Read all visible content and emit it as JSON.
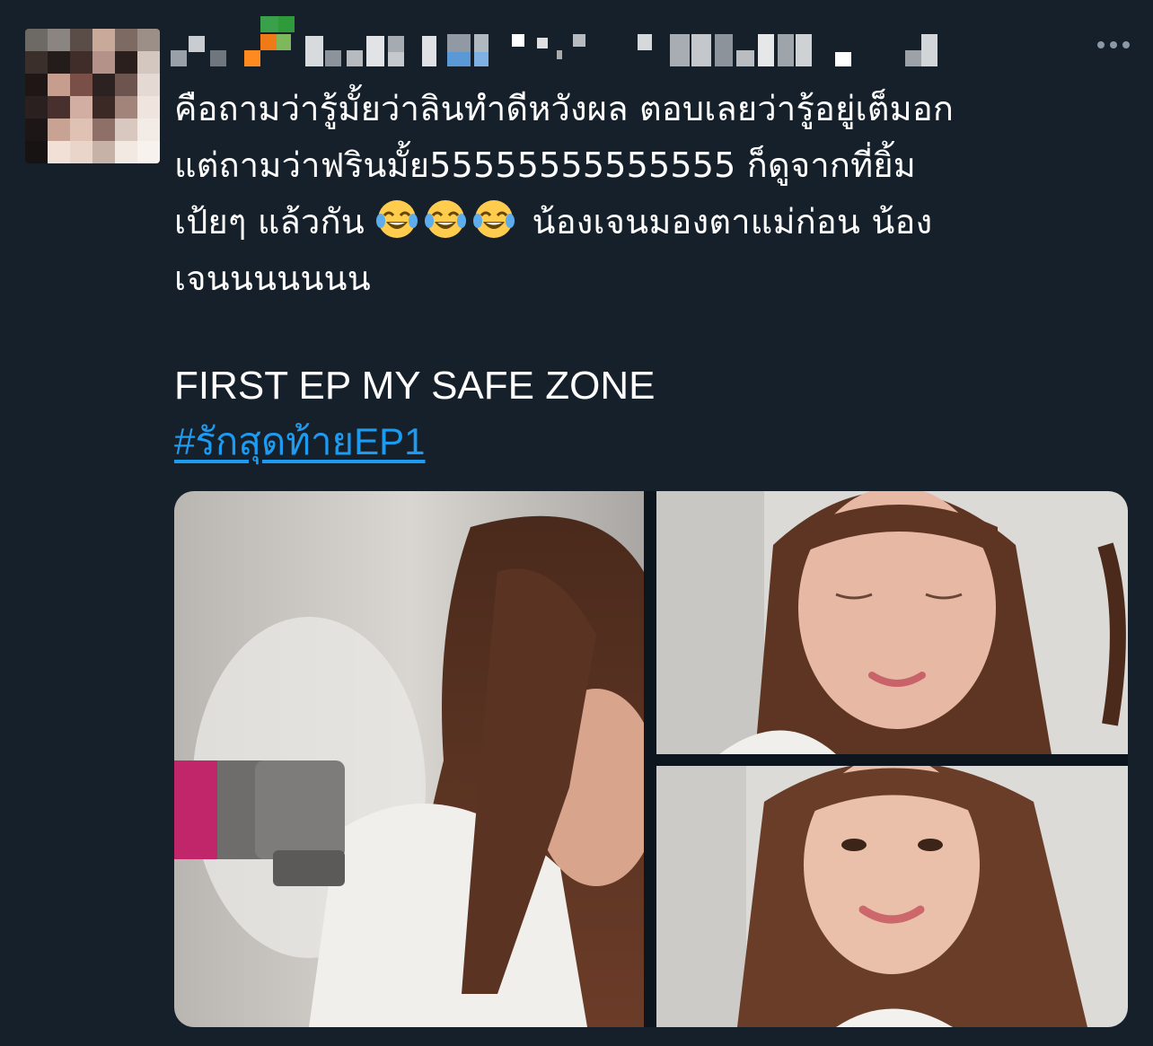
{
  "author": {
    "avatar_icon": "pixelated-avatar-icon",
    "display_name_icon": "pixelated-name-icon"
  },
  "more_menu": {
    "icon": "more-horizontal-icon"
  },
  "tweet": {
    "line1": "คือถามว่ารู้มั้ยว่าลินทำดีหวังผล ตอบเลยว่ารู้อยู่เต็มอก",
    "line2": "แต่ถามว่าฟรินมั้ย55555555555555 ก็ดูจากที่ยิ้ม",
    "line3_prefix": "เป้ยๆ แล้วกัน ",
    "line3_suffix": " น้องเจนมองตาแม่ก่อน น้อง",
    "line4": "เจนนนนนนน",
    "emoji": "face-with-tears-of-joy-icon",
    "title": "FIRST EP MY SAFE ZONE",
    "hashtag": "#รักสุดท้ายEP1"
  },
  "media": {
    "images": [
      {
        "name": "photo-woman-hair-dryer"
      },
      {
        "name": "photo-woman-eyes-closed-smiling"
      },
      {
        "name": "photo-woman-smiling"
      }
    ]
  },
  "colors": {
    "background": "#15202b",
    "text": "#ffffff",
    "link": "#1d9bf0"
  }
}
